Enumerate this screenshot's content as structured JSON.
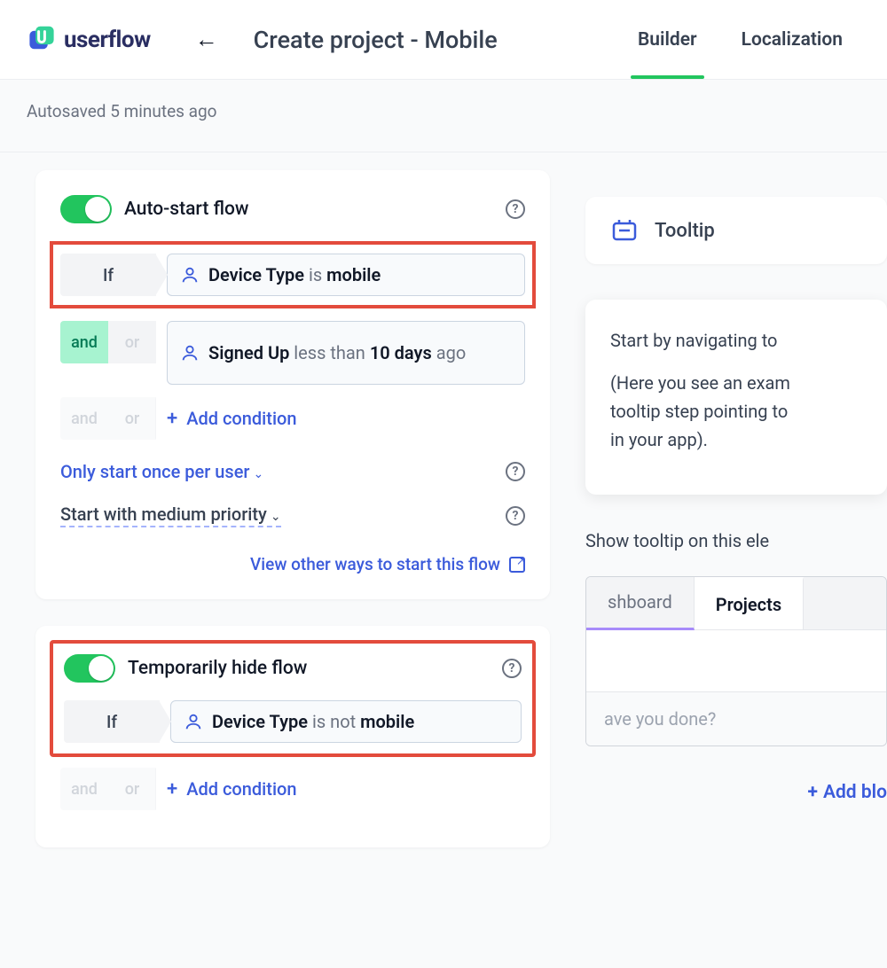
{
  "header": {
    "logo_text": "userflow",
    "page_title": "Create project - Mobile",
    "tabs": [
      {
        "label": "Builder",
        "active": true
      },
      {
        "label": "Localization",
        "active": false
      }
    ]
  },
  "autosave": "Autosaved 5 minutes ago",
  "auto_start_card": {
    "title": "Auto-start flow",
    "if_label": "If",
    "cond1": {
      "attr": "Device Type",
      "op": "is",
      "val": "mobile"
    },
    "and_label": "and",
    "or_label": "or",
    "cond2_html": {
      "attr": "Signed Up",
      "op": "less than",
      "val": "10 days",
      "suffix": "ago"
    },
    "add_condition": "Add condition",
    "once_per_user": "Only start once per user",
    "priority": "Start with medium priority",
    "view_other": "View other ways to start this flow"
  },
  "hide_card": {
    "title": "Temporarily hide flow",
    "if_label": "If",
    "cond1": {
      "attr": "Device Type",
      "op": "is not",
      "val": "mobile"
    },
    "add_condition": "Add condition",
    "and_label": "and",
    "or_label": "or"
  },
  "right": {
    "tooltip_label": "Tooltip",
    "preview_p1": "Start by navigating to",
    "preview_p2": "(Here you see an exam",
    "preview_p2b": "tooltip step pointing to",
    "preview_p2c": "in your app).",
    "show_on": "Show tooltip on this ele",
    "tab1": "shboard",
    "tab2": "Projects",
    "footer_text": "ave you done?",
    "add_block": "Add blo"
  }
}
